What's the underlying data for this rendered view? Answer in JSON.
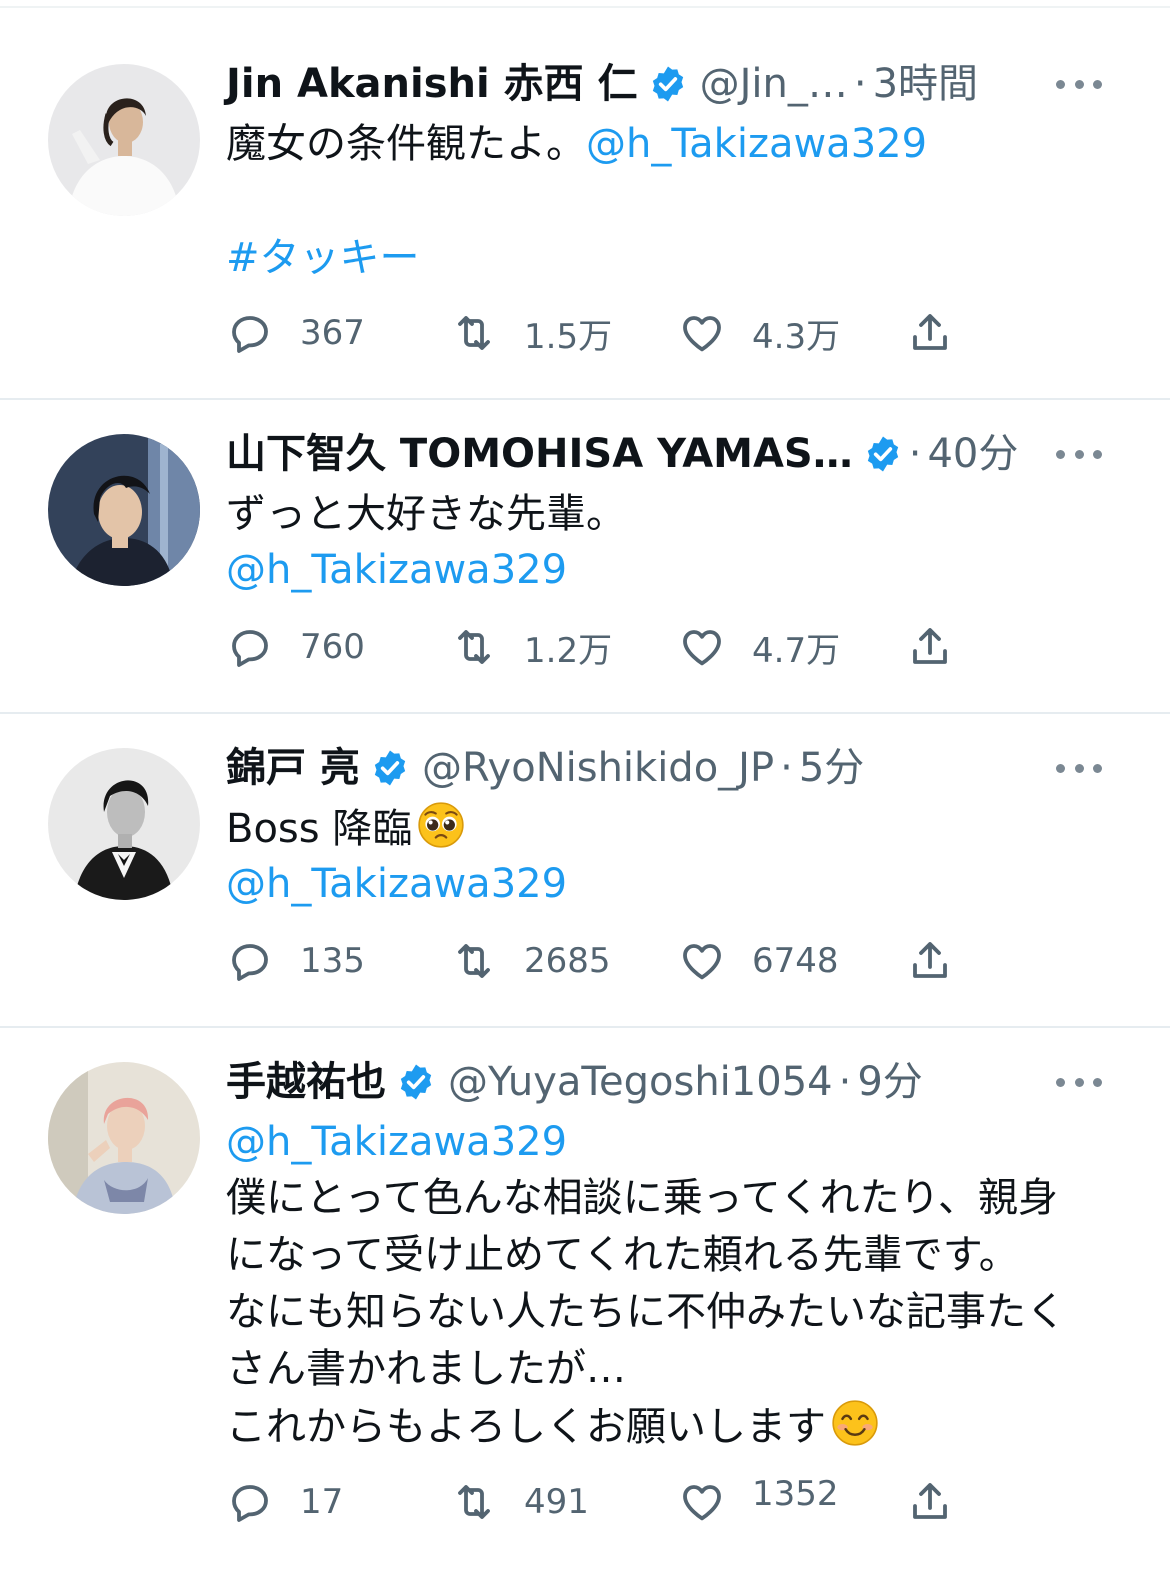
{
  "accent_color": "#1d9bf0",
  "text_color": "#0f1419",
  "secondary_color": "#536471",
  "verified_color": "#1d9bf0",
  "tweets": [
    {
      "name": "Jin Akanishi  赤西 仁",
      "handle": "@Jin_…",
      "separator": "·",
      "time": "3時間",
      "lines": {
        "l1_text": "魔女の条件観たよ。",
        "l1_mention": "@h_Takizawa329",
        "l2_hashtag": "#タッキー"
      },
      "replies": "367",
      "retweets": "1.5万",
      "likes": "4.3万"
    },
    {
      "name": "山下智久 TOMOHISA YAMAS…",
      "separator": "·",
      "time": "40分",
      "lines": {
        "l1_text": "ずっと大好きな先輩。",
        "l2_mention": "@h_Takizawa329"
      },
      "replies": "760",
      "retweets": "1.2万",
      "likes": "4.7万"
    },
    {
      "name": "錦戸 亮",
      "handle": "@RyoNishikido_JP",
      "separator": "·",
      "time": "5分",
      "lines": {
        "l1_text": "Boss 降臨",
        "l1_emoji": "pleading-face-emoji",
        "l2_mention": "@h_Takizawa329"
      },
      "replies": "135",
      "retweets": "2685",
      "likes": "6748"
    },
    {
      "name": "手越祐也",
      "handle": "@YuyaTegoshi1054",
      "separator": "·",
      "time": "9分",
      "lines": {
        "l1_mention": "@h_Takizawa329",
        "l2_text": "僕にとって色んな相談に乗ってくれたり、親身",
        "l3_text": "になって受け止めてくれた頼れる先輩です。",
        "l4_text": "なにも知らない人たちに不仲みたいな記事たく",
        "l5_text": "さん書かれましたが…",
        "l6_text": "これからもよろしくお願いします",
        "l6_emoji": "smiling-face-emoji"
      },
      "replies": "17",
      "retweets": "491",
      "likes": "1352"
    }
  ],
  "icons": {
    "reply": "speech-bubble-icon",
    "retweet": "retweet-arrows-icon",
    "like": "heart-icon",
    "share": "share-upload-icon",
    "more": "more-dots-icon",
    "verified": "verified-badge-icon"
  }
}
